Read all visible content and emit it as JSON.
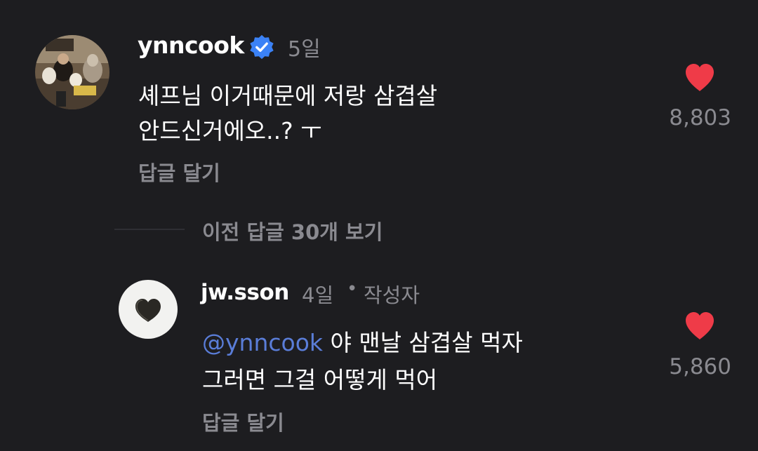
{
  "comments": [
    {
      "username": "ynncook",
      "verified": true,
      "time": "5일",
      "text_line1": "셰프님 이거때문에 저랑 삼겹살",
      "text_line2": "안드신거에오..? ㅜ",
      "reply_label": "답글 달기",
      "likes": "8,803",
      "avatar": "avatar-photo-with-dogs"
    }
  ],
  "thread": {
    "view_previous_label": "이전 답글 30개 보기"
  },
  "replies": [
    {
      "username": "jw.sson",
      "time": "4일",
      "separator": "•",
      "author_badge": "작성자",
      "mention": "@ynncook",
      "text_line1_rest": " 야 맨날 삼겹살 먹자",
      "text_line2": "그러면 그걸 어떻게 먹어",
      "reply_label": "답글 달기",
      "likes": "5,860",
      "avatar": "avatar-heart-shaped-food"
    }
  ],
  "colors": {
    "background": "#1d1d20",
    "muted_text": "#8a8a90",
    "heart": "#ef3b48",
    "verified": "#3b82f6",
    "mention": "#5a7dd8"
  },
  "icons": [
    "heart-icon",
    "verified-badge-icon"
  ]
}
